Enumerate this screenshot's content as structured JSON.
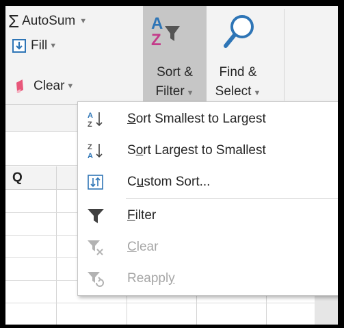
{
  "ribbon": {
    "autosum": {
      "label": "AutoSum",
      "icon": "sigma-icon"
    },
    "fill": {
      "label": "Fill",
      "icon": "fill-down-icon"
    },
    "clear": {
      "label": "Clear",
      "icon": "eraser-icon"
    },
    "sort_filter": {
      "line1": "Sort &",
      "line2": "Filter",
      "icon": "sort-filter-icon"
    },
    "find_select": {
      "line1": "Find &",
      "line2": "Select",
      "icon": "magnifier-icon"
    }
  },
  "sheet": {
    "column_header": "Q"
  },
  "menu": {
    "items": [
      {
        "pre": "",
        "acc": "S",
        "post": "ort Smallest to Largest",
        "enabled": true,
        "icon": "sort-ascending-icon"
      },
      {
        "pre": "S",
        "acc": "o",
        "post": "rt Largest to Smallest",
        "enabled": true,
        "icon": "sort-descending-icon"
      },
      {
        "pre": "C",
        "acc": "u",
        "post": "stom Sort...",
        "enabled": true,
        "icon": "custom-sort-icon"
      },
      {
        "pre": "",
        "acc": "F",
        "post": "ilter",
        "enabled": true,
        "icon": "filter-icon"
      },
      {
        "pre": "",
        "acc": "C",
        "post": "lear",
        "enabled": false,
        "icon": "clear-filter-icon"
      },
      {
        "pre": "Reappl",
        "acc": "y",
        "post": "",
        "enabled": false,
        "icon": "reapply-filter-icon"
      }
    ]
  },
  "colors": {
    "accent_blue": "#2e75b6",
    "highlight": "#c6c6c6",
    "eraser_pink": "#e8577a",
    "disabled_text": "#a6a6a6"
  }
}
